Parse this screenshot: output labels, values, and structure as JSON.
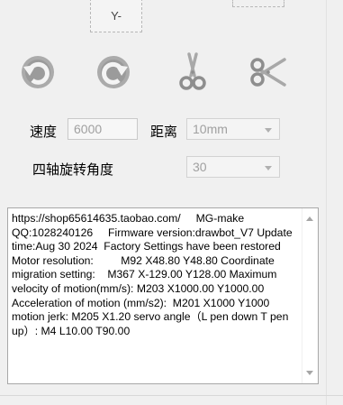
{
  "jog": {
    "y_minus_label": "Y-"
  },
  "toolbar": {
    "buttons": [
      {
        "icon": "rotate-ccw-icon"
      },
      {
        "icon": "rotate-cw-icon"
      },
      {
        "icon": "scissors-vertical-icon"
      },
      {
        "icon": "scissors-horizontal-icon"
      }
    ]
  },
  "speed": {
    "label": "速度",
    "value": "6000"
  },
  "distance": {
    "label": "距离",
    "value": "10mm"
  },
  "rotation": {
    "label": "四轴旋转角度",
    "value": "30"
  },
  "log": {
    "text": "https://shop65614635.taobao.com/     MG-make QQ:1028240126     Firmware version:drawbot_V7 Update time:Aug 30 2024  Factory Settings have been restored Motor resolution:         M92 X48.80 Y48.80 Coordinate migration setting:    M367 X-129.00 Y128.00 Maximum velocity of motion(mm/s): M203 X1000.00 Y1000.00 Acceleration of motion (mm/s2):  M201 X1000 Y1000 motion jerk: M205 X1.20 servo angle（L pen down T pen up）: M4 L10.00 T90.00"
  },
  "colors": {
    "icon_gray": "#9a9a9a",
    "icon_light": "#cfcfcf",
    "background": "#f0f0f0"
  }
}
